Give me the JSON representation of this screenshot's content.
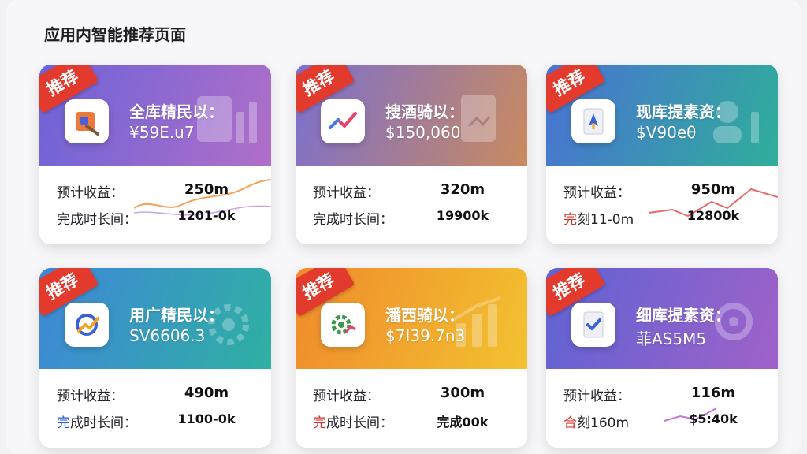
{
  "page": {
    "title": "应用内智能推荐页面"
  },
  "badge_label": "推荐",
  "cards": [
    {
      "name": "全库精民以：",
      "price": "¥59E.u7",
      "earnings_label": "预计收益：",
      "earnings_value": "250m",
      "duration_label": "完成时长间：",
      "duration_value": "1201-0k",
      "gradient": [
        "#6c63d8",
        "#b06fc8"
      ],
      "icon": "tools-icon",
      "spark_color": "#f2a35a"
    },
    {
      "name": "搜酒骑以：",
      "price": "$150,060",
      "earnings_label": "预计收益：",
      "earnings_value": "320m",
      "duration_label": "完成时长间：",
      "duration_value": "19900k",
      "gradient": [
        "#7b6fd0",
        "#c98a5f"
      ],
      "icon": "trend-chart-icon",
      "spark_color": null
    },
    {
      "name": "现库提素资：",
      "price": "$V90eθ",
      "earnings_label": "预计收益：",
      "earnings_value": "950m",
      "duration_label_prefix": "完",
      "duration_label_rest": "刻11-0m",
      "duration_value": "12800k",
      "gradient": [
        "#4a72d4",
        "#2fae9a"
      ],
      "icon": "document-rocket-icon",
      "spark_color": "#e66a6a"
    },
    {
      "name": "用广精民以：",
      "price": "SV6606.3",
      "earnings_label": "预计收益：",
      "earnings_value": "490m",
      "duration_label_prefix": "完",
      "duration_label_rest": "成时长间：",
      "duration_value": "1100-0k",
      "gradient": [
        "#3f87d9",
        "#2fb0a2"
      ],
      "icon": "analytics-icon",
      "spark_color": null
    },
    {
      "name": "潘西骑以：",
      "price": "$7I39.7n3",
      "earnings_label": "预计收益：",
      "earnings_value": "300m",
      "duration_label_prefix": "完",
      "duration_label_rest": "成时长间：",
      "duration_value": "完成00k",
      "gradient": [
        "#f08a2c",
        "#f2c230"
      ],
      "icon": "gear-chart-icon",
      "spark_color": null
    },
    {
      "name": "细库提素资：",
      "price": "菲AS5M5",
      "earnings_label": "预计收益：",
      "earnings_value": "116m",
      "duration_label_prefix": "合",
      "duration_label_rest": "刻160m",
      "duration_value": "$5:40k",
      "gradient": [
        "#5e63d3",
        "#a061c9"
      ],
      "icon": "document-check-icon",
      "spark_color": "#c678d8"
    }
  ]
}
